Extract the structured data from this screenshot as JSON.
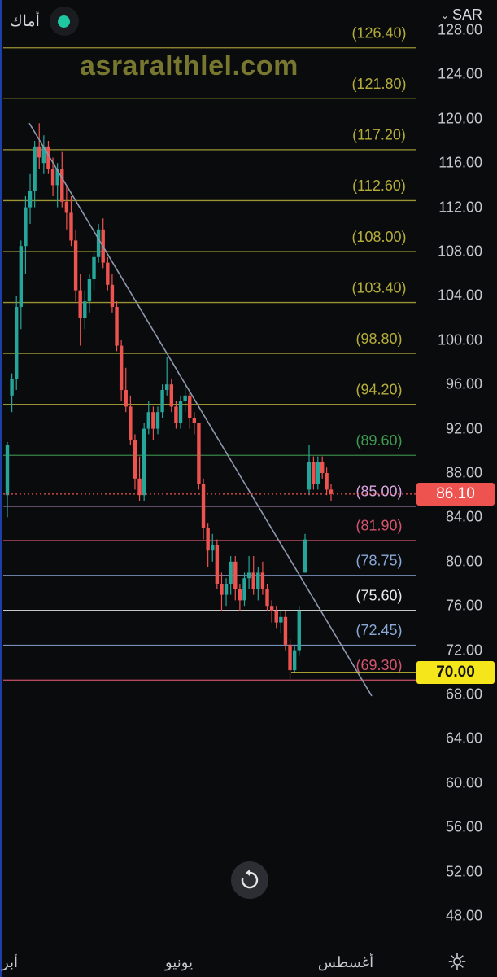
{
  "header": {
    "symbol": "أماك",
    "currency": "SAR",
    "status_color": "#1fc7a0"
  },
  "watermark": "asraralthlel.com",
  "price_axis": {
    "ticks": [
      "128.00",
      "124.00",
      "120.00",
      "116.00",
      "112.00",
      "108.00",
      "104.00",
      "100.00",
      "96.00",
      "92.00",
      "88.00",
      "84.00",
      "80.00",
      "76.00",
      "72.00",
      "68.00",
      "64.00",
      "60.00",
      "56.00",
      "52.00",
      "48.00"
    ]
  },
  "time_axis": {
    "labels": [
      "أبر",
      "يونيو",
      "أغسطس"
    ]
  },
  "badges": {
    "last_price": "86.10",
    "alert_price": "70.00"
  },
  "fib_levels": [
    {
      "label": "(126.40)",
      "value": 126.4,
      "color": "#b5ad3a"
    },
    {
      "label": "(121.80)",
      "value": 121.8,
      "color": "#b5ad3a"
    },
    {
      "label": "(117.20)",
      "value": 117.2,
      "color": "#b5ad3a"
    },
    {
      "label": "(112.60)",
      "value": 112.6,
      "color": "#b5ad3a"
    },
    {
      "label": "(108.00)",
      "value": 108.0,
      "color": "#b5ad3a"
    },
    {
      "label": "(103.40)",
      "value": 103.4,
      "color": "#b5ad3a"
    },
    {
      "label": "(98.80)",
      "value": 98.8,
      "color": "#b5ad3a"
    },
    {
      "label": "(94.20)",
      "value": 94.2,
      "color": "#b5ad3a"
    },
    {
      "label": "(89.60)",
      "value": 89.6,
      "color": "#3f9a52"
    },
    {
      "label": "(85.00)",
      "value": 85.0,
      "color": "#d7a3e0"
    },
    {
      "label": "(81.90)",
      "value": 81.9,
      "color": "#d2546e"
    },
    {
      "label": "(78.75)",
      "value": 78.75,
      "color": "#8aa7d6"
    },
    {
      "label": "(75.60)",
      "value": 75.6,
      "color": "#e8e8e8"
    },
    {
      "label": "(72.45)",
      "value": 72.45,
      "color": "#8aa7d6"
    },
    {
      "label": "(69.30)",
      "value": 69.3,
      "color": "#d2546e"
    }
  ],
  "colors": {
    "up": "#26a69a",
    "down": "#ef5350",
    "trendline": "#8e98ad",
    "last_price_line": "#ef5350"
  },
  "chart_data": {
    "type": "candlestick",
    "currency": "SAR",
    "last_price": 86.1,
    "alert_price": 70.0,
    "ylim": [
      47,
      129
    ],
    "x_labels": [
      "أبر",
      "يونيو",
      "أغسطس"
    ],
    "trendline": {
      "from": {
        "price": 119.6
      },
      "to": {
        "price": 68.3
      }
    },
    "candles": [
      {
        "o": 86.0,
        "h": 90.8,
        "l": 84.0,
        "c": 90.5
      },
      {
        "o": 95.0,
        "h": 97.0,
        "l": 93.5,
        "c": 96.5
      },
      {
        "o": 96.5,
        "h": 104.0,
        "l": 95.5,
        "c": 103.0
      },
      {
        "o": 103.0,
        "h": 109.0,
        "l": 101.0,
        "c": 108.5
      },
      {
        "o": 108.5,
        "h": 113.0,
        "l": 106.0,
        "c": 112.0
      },
      {
        "o": 112.0,
        "h": 115.0,
        "l": 110.5,
        "c": 113.5
      },
      {
        "o": 113.5,
        "h": 118.0,
        "l": 112.0,
        "c": 117.5
      },
      {
        "o": 117.5,
        "h": 119.6,
        "l": 115.5,
        "c": 116.5
      },
      {
        "o": 116.0,
        "h": 118.5,
        "l": 115.0,
        "c": 117.5
      },
      {
        "o": 117.5,
        "h": 118.0,
        "l": 115.0,
        "c": 115.5
      },
      {
        "o": 115.5,
        "h": 116.5,
        "l": 113.0,
        "c": 114.0
      },
      {
        "o": 114.0,
        "h": 116.0,
        "l": 112.0,
        "c": 115.5
      },
      {
        "o": 115.5,
        "h": 117.0,
        "l": 112.0,
        "c": 112.5
      },
      {
        "o": 112.5,
        "h": 114.0,
        "l": 110.0,
        "c": 111.5
      },
      {
        "o": 111.5,
        "h": 113.0,
        "l": 108.5,
        "c": 109.0
      },
      {
        "o": 109.0,
        "h": 110.0,
        "l": 103.5,
        "c": 104.5
      },
      {
        "o": 104.5,
        "h": 106.0,
        "l": 99.5,
        "c": 102.0
      },
      {
        "o": 102.0,
        "h": 104.5,
        "l": 101.0,
        "c": 103.5
      },
      {
        "o": 103.5,
        "h": 106.0,
        "l": 102.5,
        "c": 105.5
      },
      {
        "o": 105.5,
        "h": 108.0,
        "l": 104.5,
        "c": 107.5
      },
      {
        "o": 107.5,
        "h": 110.5,
        "l": 107.0,
        "c": 110.0
      },
      {
        "o": 110.0,
        "h": 111.0,
        "l": 106.5,
        "c": 107.0
      },
      {
        "o": 107.0,
        "h": 107.5,
        "l": 104.5,
        "c": 105.0
      },
      {
        "o": 105.0,
        "h": 106.0,
        "l": 102.5,
        "c": 103.0
      },
      {
        "o": 103.0,
        "h": 103.5,
        "l": 99.0,
        "c": 99.5
      },
      {
        "o": 99.5,
        "h": 100.0,
        "l": 94.5,
        "c": 95.5
      },
      {
        "o": 95.5,
        "h": 97.5,
        "l": 93.5,
        "c": 94.0
      },
      {
        "o": 94.0,
        "h": 95.0,
        "l": 90.5,
        "c": 91.0
      },
      {
        "o": 91.0,
        "h": 91.5,
        "l": 86.5,
        "c": 87.5
      },
      {
        "o": 87.5,
        "h": 89.5,
        "l": 85.5,
        "c": 86.0
      },
      {
        "o": 86.0,
        "h": 92.5,
        "l": 85.5,
        "c": 92.0
      },
      {
        "o": 92.0,
        "h": 94.5,
        "l": 91.5,
        "c": 93.5
      },
      {
        "o": 93.5,
        "h": 94.0,
        "l": 91.0,
        "c": 92.0
      },
      {
        "o": 92.0,
        "h": 94.0,
        "l": 91.5,
        "c": 93.5
      },
      {
        "o": 93.5,
        "h": 96.0,
        "l": 93.0,
        "c": 95.5
      },
      {
        "o": 95.5,
        "h": 98.5,
        "l": 95.0,
        "c": 96.0
      },
      {
        "o": 96.0,
        "h": 96.5,
        "l": 93.5,
        "c": 94.0
      },
      {
        "o": 94.0,
        "h": 94.5,
        "l": 92.0,
        "c": 92.5
      },
      {
        "o": 92.5,
        "h": 95.0,
        "l": 92.0,
        "c": 94.5
      },
      {
        "o": 94.5,
        "h": 96.0,
        "l": 93.5,
        "c": 95.0
      },
      {
        "o": 95.0,
        "h": 95.5,
        "l": 92.0,
        "c": 93.0
      },
      {
        "o": 93.0,
        "h": 93.5,
        "l": 91.5,
        "c": 92.5
      },
      {
        "o": 92.5,
        "h": 92.5,
        "l": 86.5,
        "c": 87.0
      },
      {
        "o": 87.0,
        "h": 87.5,
        "l": 82.0,
        "c": 83.0
      },
      {
        "o": 83.0,
        "h": 83.5,
        "l": 79.5,
        "c": 81.0
      },
      {
        "o": 81.0,
        "h": 82.5,
        "l": 80.0,
        "c": 81.5
      },
      {
        "o": 81.5,
        "h": 82.0,
        "l": 77.5,
        "c": 78.0
      },
      {
        "o": 78.0,
        "h": 79.0,
        "l": 75.5,
        "c": 77.0
      },
      {
        "o": 77.0,
        "h": 78.5,
        "l": 76.0,
        "c": 78.0
      },
      {
        "o": 78.0,
        "h": 80.5,
        "l": 77.0,
        "c": 80.0
      },
      {
        "o": 80.0,
        "h": 80.5,
        "l": 76.5,
        "c": 77.5
      },
      {
        "o": 77.5,
        "h": 78.0,
        "l": 75.5,
        "c": 76.5
      },
      {
        "o": 76.5,
        "h": 79.0,
        "l": 76.0,
        "c": 78.5
      },
      {
        "o": 78.5,
        "h": 80.5,
        "l": 77.5,
        "c": 79.0
      },
      {
        "o": 79.0,
        "h": 80.5,
        "l": 77.0,
        "c": 77.5
      },
      {
        "o": 77.5,
        "h": 79.5,
        "l": 76.5,
        "c": 79.0
      },
      {
        "o": 79.0,
        "h": 80.0,
        "l": 77.0,
        "c": 77.5
      },
      {
        "o": 77.5,
        "h": 78.0,
        "l": 75.5,
        "c": 76.0
      },
      {
        "o": 76.0,
        "h": 76.5,
        "l": 74.5,
        "c": 75.5
      },
      {
        "o": 75.5,
        "h": 76.0,
        "l": 74.0,
        "c": 74.5
      },
      {
        "o": 74.5,
        "h": 75.5,
        "l": 73.5,
        "c": 75.0
      },
      {
        "o": 75.0,
        "h": 75.5,
        "l": 72.0,
        "c": 72.5
      },
      {
        "o": 72.5,
        "h": 73.0,
        "l": 69.4,
        "c": 70.2
      },
      {
        "o": 70.2,
        "h": 72.5,
        "l": 70.0,
        "c": 72.0
      },
      {
        "o": 72.0,
        "h": 76.0,
        "l": 71.5,
        "c": 75.5
      },
      {
        "o": 79.0,
        "h": 82.5,
        "l": 79.0,
        "c": 82.0
      },
      {
        "o": 86.5,
        "h": 90.5,
        "l": 86.0,
        "c": 89.0
      },
      {
        "o": 89.0,
        "h": 89.5,
        "l": 86.5,
        "c": 87.0
      },
      {
        "o": 87.0,
        "h": 89.5,
        "l": 86.5,
        "c": 89.0
      },
      {
        "o": 89.0,
        "h": 89.5,
        "l": 87.5,
        "c": 88.0
      },
      {
        "o": 88.0,
        "h": 88.5,
        "l": 86.0,
        "c": 86.5
      },
      {
        "o": 86.5,
        "h": 87.0,
        "l": 85.5,
        "c": 86.1
      }
    ]
  }
}
